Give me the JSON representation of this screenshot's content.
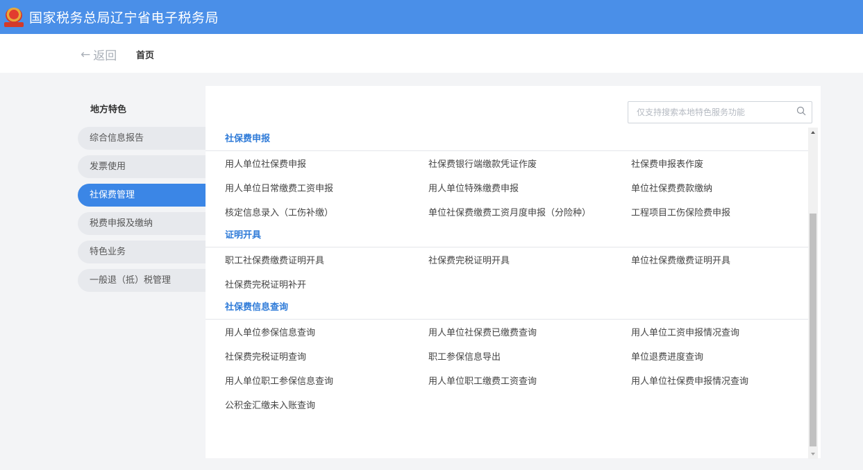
{
  "header": {
    "title": "国家税务总局辽宁省电子税务局",
    "color": "#4a8fe8"
  },
  "nav": {
    "back_label": "返回",
    "breadcrumb": "首页"
  },
  "sidebar": {
    "heading": "地方特色",
    "items": [
      {
        "label": "综合信息报告",
        "active": false
      },
      {
        "label": "发票使用",
        "active": false
      },
      {
        "label": "社保费管理",
        "active": true
      },
      {
        "label": "税费申报及缴纳",
        "active": false
      },
      {
        "label": "特色业务",
        "active": false
      },
      {
        "label": "一般退（抵）税管理",
        "active": false
      }
    ]
  },
  "search": {
    "placeholder": "仅支持搜索本地特色服务功能",
    "icon": "search-icon"
  },
  "sections": [
    {
      "title": "社保费申报",
      "rows": [
        [
          "用人单位社保费申报",
          "社保费银行端缴款凭证作废",
          "社保费申报表作废"
        ],
        [
          "用人单位日常缴费工资申报",
          "用人单位特殊缴费申报",
          "单位社保费费款缴纳"
        ],
        [
          "核定信息录入（工伤补缴）",
          "单位社保费缴费工资月度申报（分险种）",
          "工程项目工伤保险费申报"
        ]
      ]
    },
    {
      "title": "证明开具",
      "rows": [
        [
          "职工社保费缴费证明开具",
          "社保费完税证明开具",
          "单位社保费缴费证明开具"
        ],
        [
          "社保费完税证明补开",
          "",
          ""
        ]
      ]
    },
    {
      "title": "社保费信息查询",
      "rows": [
        [
          "用人单位参保信息查询",
          "用人单位社保费已缴费查询",
          "用人单位工资申报情况查询"
        ],
        [
          "社保费完税证明查询",
          "职工参保信息导出",
          "单位退费进度查询"
        ],
        [
          "用人单位职工参保信息查询",
          "用人单位职工缴费工资查询",
          "用人单位社保费申报情况查询"
        ],
        [
          "公积金汇缴未入账查询",
          "",
          ""
        ]
      ]
    }
  ]
}
